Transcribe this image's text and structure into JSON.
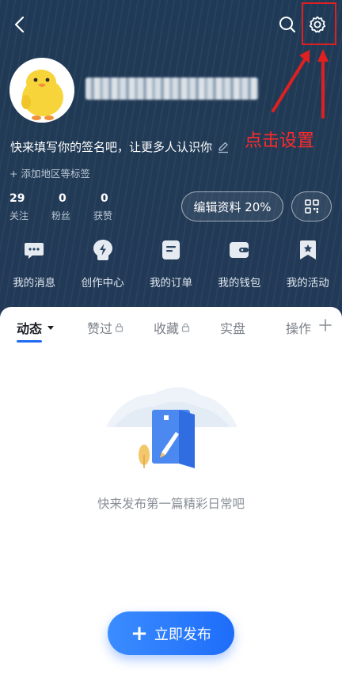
{
  "profile": {
    "signature": "快来填写你的签名吧，让更多人认识你",
    "add_tag": "+ 添加地区等标签"
  },
  "stats": [
    {
      "value": "29",
      "label": "关注"
    },
    {
      "value": "0",
      "label": "粉丝"
    },
    {
      "value": "0",
      "label": "获赞"
    }
  ],
  "actions": {
    "edit_profile": "编辑资料 20%"
  },
  "quick_menu": [
    {
      "label": "我的消息",
      "icon": "message-icon"
    },
    {
      "label": "创作中心",
      "icon": "lightning-icon"
    },
    {
      "label": "我的订单",
      "icon": "order-icon"
    },
    {
      "label": "我的钱包",
      "icon": "wallet-icon"
    },
    {
      "label": "我的活动",
      "icon": "bookmark-icon"
    }
  ],
  "tabs": [
    {
      "label": "动态"
    },
    {
      "label": "赞过"
    },
    {
      "label": "收藏"
    },
    {
      "label": "实盘"
    },
    {
      "label": "操作"
    }
  ],
  "empty_state": {
    "text": "快来发布第一篇精彩日常吧"
  },
  "publish_button": {
    "label": "立即发布"
  },
  "annotation": {
    "text": "点击设置",
    "color": "#ff2a2a"
  },
  "colors": {
    "header_bg": "#213a55",
    "accent": "#1f6bf2"
  }
}
